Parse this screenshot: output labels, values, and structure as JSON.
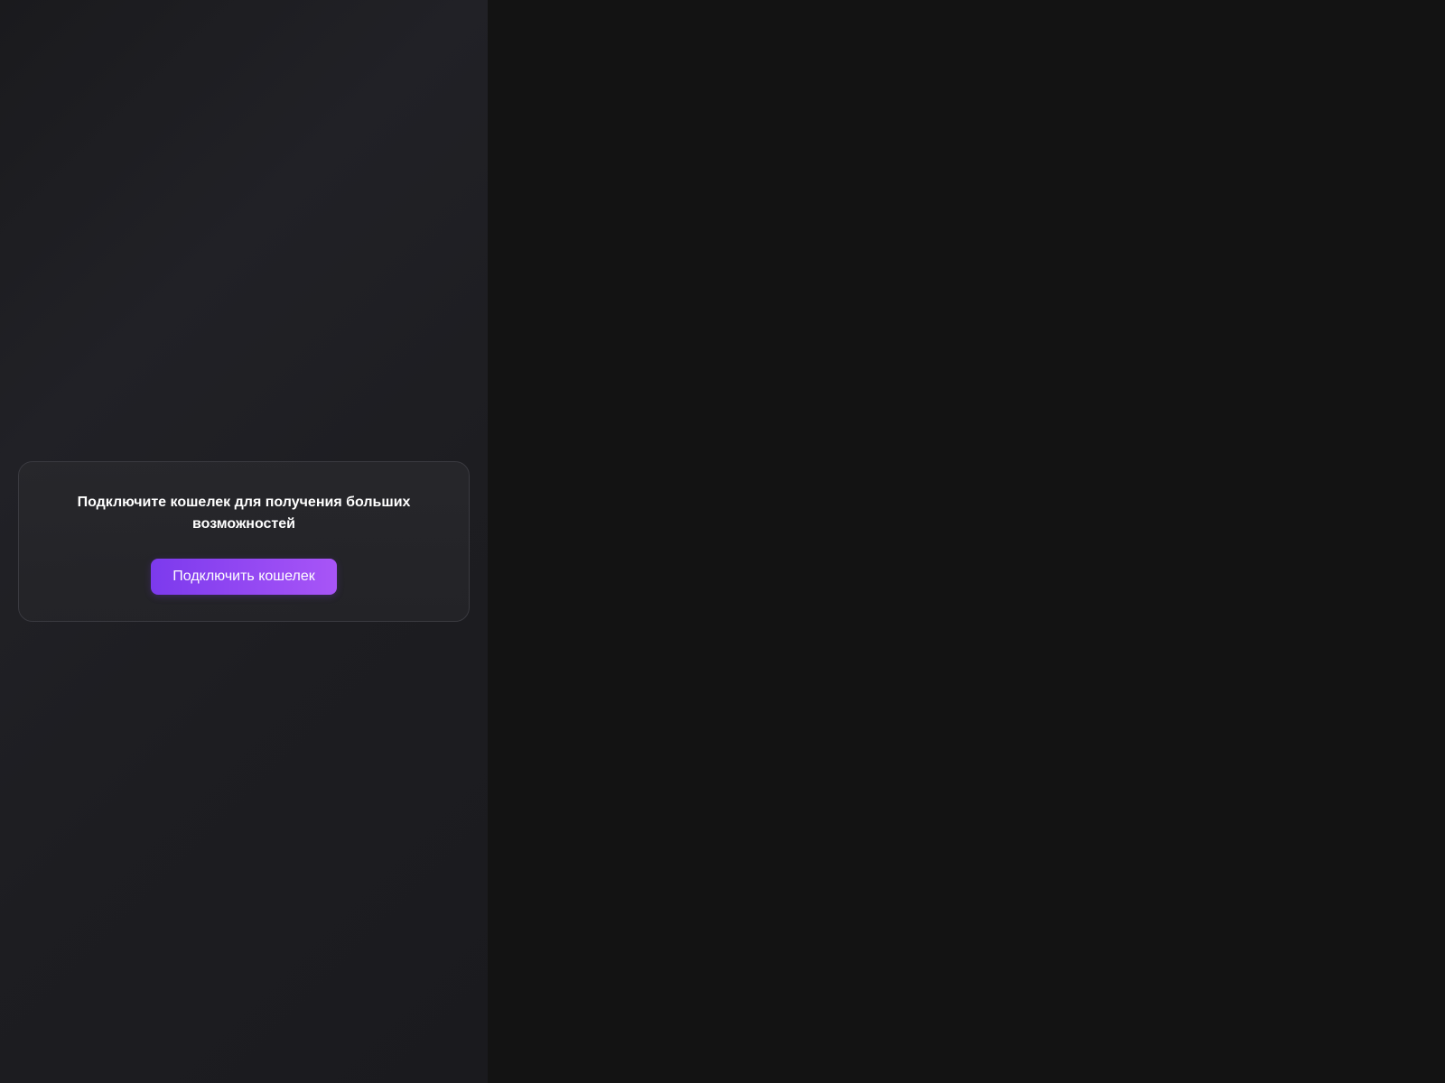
{
  "sidebar": {
    "wallet_prompt": {
      "message": "Подключите кошелек для получения больших возможностей",
      "button_label": "Подключить кошелек"
    }
  },
  "colors": {
    "accent_start": "#7c3aed",
    "accent_end": "#a855f7",
    "background": "#131313",
    "sidebar_background": "#1e1e22"
  }
}
